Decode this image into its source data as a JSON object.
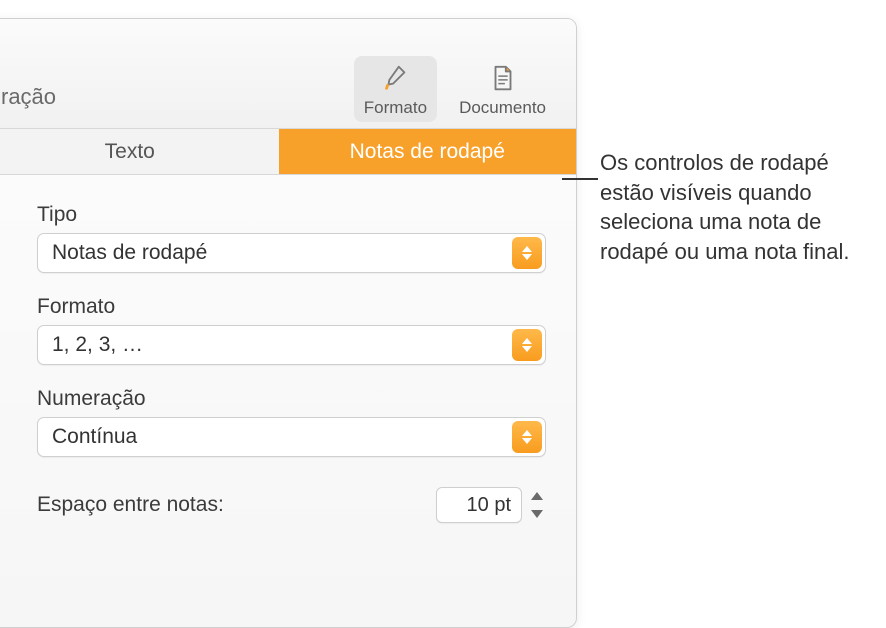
{
  "toolbar": {
    "left_label_fragment": "ração",
    "format_label": "Formato",
    "document_label": "Documento"
  },
  "tabs": {
    "text": "Texto",
    "footnotes": "Notas de rodapé"
  },
  "panel": {
    "type_label": "Tipo",
    "type_value": "Notas de rodapé",
    "format_label": "Formato",
    "format_value": "1, 2, 3, …",
    "numbering_label": "Numeração",
    "numbering_value": "Contínua",
    "spacing_label": "Espaço entre notas:",
    "spacing_value": "10 pt"
  },
  "callout": "Os controlos de rodapé estão visíveis quando seleciona uma nota de rodapé ou uma nota final.",
  "colors": {
    "accent": "#f89c1f"
  }
}
